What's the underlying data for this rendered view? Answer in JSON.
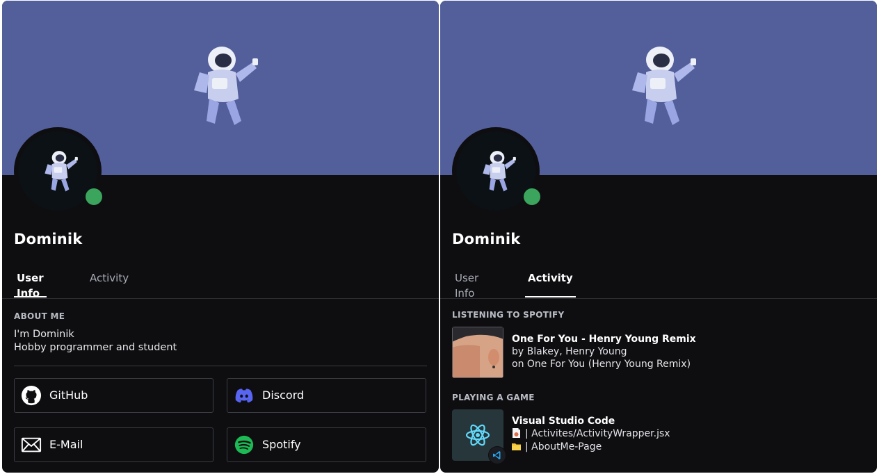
{
  "colors": {
    "banner": "#525f9a",
    "card_bg": "#0e0e11",
    "status_online": "#3ba55d",
    "astronaut": "#7f8ee0",
    "discord": "#5865f2",
    "spotify": "#1db954",
    "react": "#61dafb",
    "vscode": "#23a9f2"
  },
  "left_card": {
    "username": "Dominik",
    "tabs": [
      {
        "label": "User Info",
        "active": true
      },
      {
        "label": "Activity",
        "active": false
      }
    ],
    "about": {
      "title": "ABOUT ME",
      "lines": [
        "I'm Dominik",
        "Hobby programmer and student"
      ]
    },
    "links": [
      {
        "label": "GitHub",
        "icon": "github-icon"
      },
      {
        "label": "Discord",
        "icon": "discord-icon"
      },
      {
        "label": "E-Mail",
        "icon": "mail-icon"
      },
      {
        "label": "Spotify",
        "icon": "spotify-icon"
      }
    ]
  },
  "right_card": {
    "username": "Dominik",
    "tabs": [
      {
        "label": "User Info",
        "active": false
      },
      {
        "label": "Activity",
        "active": true
      }
    ],
    "spotify": {
      "section_title": "LISTENING TO SPOTIFY",
      "track": "One For You - Henry Young Remix",
      "artists": "by Blakey, Henry Young",
      "album": "on One For You (Henry Young Remix)"
    },
    "game": {
      "section_title": "PLAYING A GAME",
      "name": "Visual Studio Code",
      "file_prefix": "| Activites/ActivityWrapper.jsx",
      "workspace_prefix": "| AboutMe-Page"
    }
  }
}
